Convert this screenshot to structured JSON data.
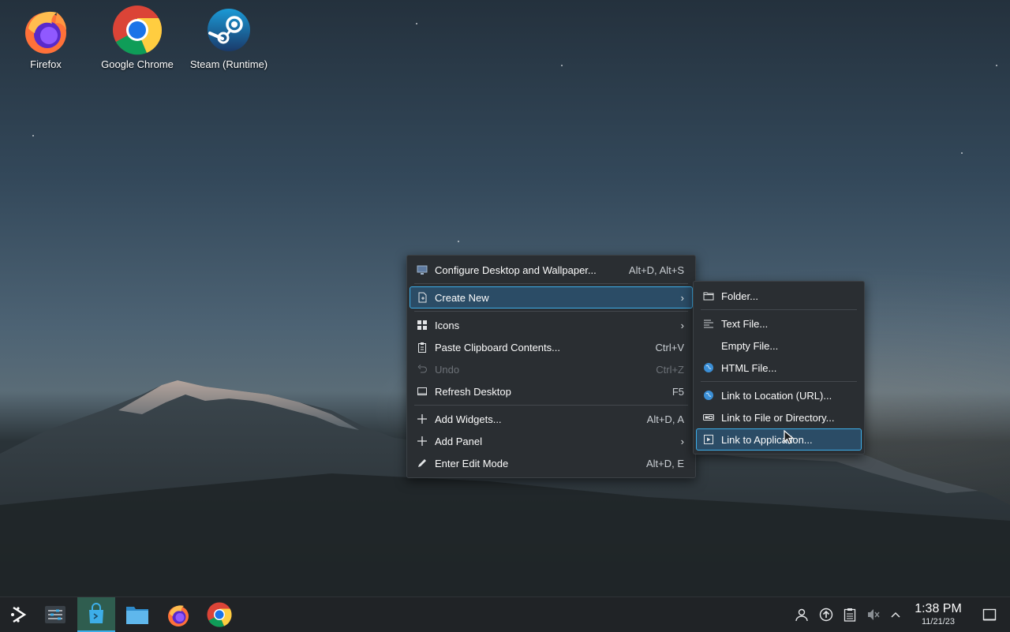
{
  "desktop": {
    "icons": [
      {
        "label": "Firefox",
        "icon": "firefox-icon"
      },
      {
        "label": "Google Chrome",
        "icon": "chrome-icon"
      },
      {
        "label": "Steam (Runtime)",
        "icon": "steam-icon"
      }
    ]
  },
  "context_menu": {
    "items": [
      {
        "label": "Configure Desktop and Wallpaper...",
        "shortcut": "Alt+D, Alt+S",
        "icon": "monitor-icon"
      },
      {
        "label": "Create New",
        "icon": "new-document-icon",
        "submenu": true,
        "highlighted": true
      },
      {
        "label": "Icons",
        "icon": "grid-icon",
        "submenu": true
      },
      {
        "label": "Paste Clipboard Contents...",
        "shortcut": "Ctrl+V",
        "icon": "clipboard-icon"
      },
      {
        "label": "Undo",
        "shortcut": "Ctrl+Z",
        "icon": "undo-icon",
        "disabled": true
      },
      {
        "label": "Refresh Desktop",
        "shortcut": "F5",
        "icon": "refresh-desktop-icon"
      },
      {
        "label": "Add Widgets...",
        "shortcut": "Alt+D, A",
        "icon": "plus-icon"
      },
      {
        "label": "Add Panel",
        "icon": "plus-icon",
        "submenu": true
      },
      {
        "label": "Enter Edit Mode",
        "shortcut": "Alt+D, E",
        "icon": "pencil-icon"
      }
    ]
  },
  "create_new_submenu": {
    "items": [
      {
        "label": "Folder...",
        "icon": "folder-icon"
      },
      {
        "label": "Text File...",
        "icon": "text-file-icon"
      },
      {
        "label": "Empty File...",
        "icon": "empty-file-icon"
      },
      {
        "label": "HTML File...",
        "icon": "globe-icon"
      },
      {
        "label": "Link to Location (URL)...",
        "icon": "globe-icon"
      },
      {
        "label": "Link to File or Directory...",
        "icon": "link-icon"
      },
      {
        "label": "Link to Application...",
        "icon": "application-icon",
        "highlighted": true
      }
    ]
  },
  "taskbar": {
    "apps": [
      "application-launcher-icon",
      "system-settings-icon",
      "discover-store-icon",
      "file-manager-icon",
      "firefox-icon",
      "chrome-icon"
    ],
    "tray": [
      "user-icon",
      "update-icon",
      "clipboard-icon",
      "volume-muted-icon",
      "chevron-up-icon"
    ],
    "clock_time": "1:38 PM",
    "clock_date": "11/21/23"
  },
  "colors": {
    "accent": "#3daee9",
    "menu_bg": "#2a2e32",
    "highlight_bg": "#2b4c66",
    "taskbar_bg": "#202326"
  }
}
